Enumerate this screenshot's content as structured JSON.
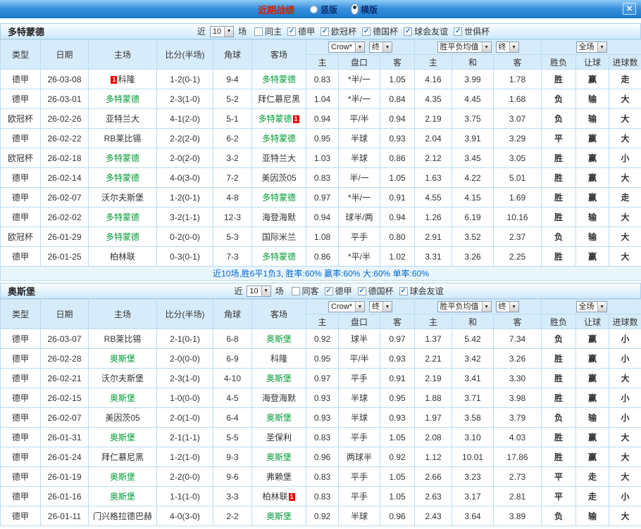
{
  "titlebar": {
    "title": "近期战绩",
    "layout_options": [
      {
        "label": "竖版",
        "selected": false
      },
      {
        "label": "横版",
        "selected": true
      }
    ],
    "close_label": "✕"
  },
  "colors": {
    "league_bundesliga": "#8f6dbe",
    "league_champions": "#e0622e",
    "focus_team_green": "#009933",
    "score_red": "#e60000",
    "result_red": "#e60000",
    "result_blue": "#2e6ed5",
    "result_green": "#1e9e3e",
    "accent_blue": "#1673cf"
  },
  "league_classes": {
    "德甲": "de",
    "欧冠杯": "cl"
  },
  "sections": [
    {
      "team": "多特蒙德",
      "filter": {
        "near_label": "近",
        "count": "10",
        "games_label": "场",
        "checkboxes": [
          {
            "label": "同主",
            "checked": false
          },
          {
            "label": "德甲",
            "checked": true
          },
          {
            "label": "欧冠杯",
            "checked": true
          },
          {
            "label": "德国杯",
            "checked": true
          },
          {
            "label": "球会友谊",
            "checked": true
          },
          {
            "label": "世俱杯",
            "checked": true
          }
        ]
      },
      "header": {
        "columns": [
          "类型",
          "日期",
          "主场",
          "比分(半场)",
          "角球",
          "客场"
        ],
        "odds_company_select": "Crow*",
        "odds_final_select": "终",
        "avg_select": "胜平负均值",
        "avg_final_select": "终",
        "fulltime_select": "全场",
        "subcolumns": [
          "主",
          "盘口",
          "客",
          "主",
          "和",
          "客",
          "胜负",
          "让球",
          "进球数"
        ]
      },
      "rows": [
        {
          "league": "德甲",
          "date": "26-03-08",
          "home": {
            "name": "科隆",
            "focus": false,
            "badge": "1",
            "badge_pos": "before"
          },
          "score": "1-2(0-1)",
          "corners": "9-4",
          "away": {
            "name": "多特蒙德",
            "focus": true
          },
          "odds": [
            "0.83",
            "*半/一",
            "1.05"
          ],
          "avg": [
            "4.16",
            "3.99",
            "1.78"
          ],
          "results": [
            {
              "text": "胜",
              "color": "red"
            },
            {
              "text": "赢",
              "color": "red"
            },
            {
              "text": "走",
              "color": "red"
            }
          ]
        },
        {
          "league": "德甲",
          "date": "26-03-01",
          "home": {
            "name": "多特蒙德",
            "focus": true
          },
          "score": "2-3(1-0)",
          "corners": "5-2",
          "away": {
            "name": "拜仁慕尼黑",
            "focus": false
          },
          "odds": [
            "1.04",
            "*半/一",
            "0.84"
          ],
          "avg": [
            "4.35",
            "4.45",
            "1.68"
          ],
          "results": [
            {
              "text": "负",
              "color": "red"
            },
            {
              "text": "输",
              "color": "blue"
            },
            {
              "text": "大",
              "color": "red"
            }
          ]
        },
        {
          "league": "欧冠杯",
          "date": "26-02-26",
          "home": {
            "name": "亚特兰大",
            "focus": false
          },
          "score": "4-1(2-0)",
          "corners": "5-1",
          "away": {
            "name": "多特蒙德",
            "focus": true,
            "badge": "1",
            "badge_pos": "after"
          },
          "odds": [
            "0.94",
            "平/半",
            "0.94"
          ],
          "avg": [
            "2.19",
            "3.75",
            "3.07"
          ],
          "results": [
            {
              "text": "负",
              "color": "red"
            },
            {
              "text": "输",
              "color": "blue"
            },
            {
              "text": "大",
              "color": "red"
            }
          ]
        },
        {
          "league": "德甲",
          "date": "26-02-22",
          "home": {
            "name": "RB莱比锡",
            "focus": false
          },
          "score": "2-2(2-0)",
          "corners": "6-2",
          "away": {
            "name": "多特蒙德",
            "focus": true
          },
          "odds": [
            "0.95",
            "半球",
            "0.93"
          ],
          "avg": [
            "2.04",
            "3.91",
            "3.29"
          ],
          "results": [
            {
              "text": "平",
              "color": "blue"
            },
            {
              "text": "赢",
              "color": "red"
            },
            {
              "text": "大",
              "color": "red"
            }
          ]
        },
        {
          "league": "欧冠杯",
          "date": "26-02-18",
          "home": {
            "name": "多特蒙德",
            "focus": true
          },
          "score": "2-0(2-0)",
          "corners": "3-2",
          "away": {
            "name": "亚特兰大",
            "focus": false
          },
          "odds": [
            "1.03",
            "半球",
            "0.86"
          ],
          "avg": [
            "2.12",
            "3.45",
            "3.05"
          ],
          "results": [
            {
              "text": "胜",
              "color": "red"
            },
            {
              "text": "赢",
              "color": "red"
            },
            {
              "text": "小",
              "color": "green"
            }
          ]
        },
        {
          "league": "德甲",
          "date": "26-02-14",
          "home": {
            "name": "多特蒙德",
            "focus": true
          },
          "score": "4-0(3-0)",
          "corners": "7-2",
          "away": {
            "name": "美因茨05",
            "focus": false
          },
          "odds": [
            "0.83",
            "半/一",
            "1.05"
          ],
          "avg": [
            "1.63",
            "4.22",
            "5.01"
          ],
          "results": [
            {
              "text": "胜",
              "color": "red"
            },
            {
              "text": "赢",
              "color": "red"
            },
            {
              "text": "大",
              "color": "red"
            }
          ]
        },
        {
          "league": "德甲",
          "date": "26-02-07",
          "home": {
            "name": "沃尔夫斯堡",
            "focus": false
          },
          "score": "1-2(0-1)",
          "corners": "4-8",
          "away": {
            "name": "多特蒙德",
            "focus": true
          },
          "odds": [
            "0.97",
            "*半/一",
            "0.91"
          ],
          "avg": [
            "4.55",
            "4.15",
            "1.69"
          ],
          "results": [
            {
              "text": "胜",
              "color": "red"
            },
            {
              "text": "赢",
              "color": "red"
            },
            {
              "text": "走",
              "color": "red"
            }
          ]
        },
        {
          "league": "德甲",
          "date": "26-02-02",
          "home": {
            "name": "多特蒙德",
            "focus": true
          },
          "score": "3-2(1-1)",
          "corners": "12-3",
          "away": {
            "name": "海登海默",
            "focus": false
          },
          "odds": [
            "0.94",
            "球半/两",
            "0.94"
          ],
          "avg": [
            "1.26",
            "6.19",
            "10.16"
          ],
          "results": [
            {
              "text": "胜",
              "color": "red"
            },
            {
              "text": "输",
              "color": "blue"
            },
            {
              "text": "大",
              "color": "red"
            }
          ]
        },
        {
          "league": "欧冠杯",
          "date": "26-01-29",
          "home": {
            "name": "多特蒙德",
            "focus": true
          },
          "score": "0-2(0-0)",
          "corners": "5-3",
          "away": {
            "name": "国际米兰",
            "focus": false
          },
          "odds": [
            "1.08",
            "平手",
            "0.80"
          ],
          "avg": [
            "2.91",
            "3.52",
            "2.37"
          ],
          "results": [
            {
              "text": "负",
              "color": "red"
            },
            {
              "text": "输",
              "color": "blue"
            },
            {
              "text": "大",
              "color": "red"
            }
          ]
        },
        {
          "league": "德甲",
          "date": "26-01-25",
          "home": {
            "name": "柏林联",
            "focus": false
          },
          "score": "0-3(0-1)",
          "corners": "7-3",
          "away": {
            "name": "多特蒙德",
            "focus": true
          },
          "odds": [
            "0.86",
            "*平/半",
            "1.02"
          ],
          "avg": [
            "3.31",
            "3.26",
            "2.25"
          ],
          "results": [
            {
              "text": "胜",
              "color": "red"
            },
            {
              "text": "赢",
              "color": "red"
            },
            {
              "text": "大",
              "color": "red"
            }
          ]
        }
      ],
      "summary": "近10场,胜6平1负3, 胜率:60% 赢率:60% 大:60% 单率:60%"
    },
    {
      "team": "奥斯堡",
      "filter": {
        "near_label": "近",
        "count": "10",
        "games_label": "场",
        "checkboxes": [
          {
            "label": "同客",
            "checked": false
          },
          {
            "label": "德甲",
            "checked": true
          },
          {
            "label": "德国杯",
            "checked": true
          },
          {
            "label": "球会友谊",
            "checked": true
          }
        ]
      },
      "header": {
        "columns": [
          "类型",
          "日期",
          "主场",
          "比分(半场)",
          "角球",
          "客场"
        ],
        "odds_company_select": "Crow*",
        "odds_final_select": "终",
        "avg_select": "胜平负均值",
        "avg_final_select": "终",
        "fulltime_select": "全场",
        "subcolumns": [
          "主",
          "盘口",
          "客",
          "主",
          "和",
          "客",
          "胜负",
          "让球",
          "进球数"
        ]
      },
      "rows": [
        {
          "league": "德甲",
          "date": "26-03-07",
          "home": {
            "name": "RB莱比锡",
            "focus": false
          },
          "score": "2-1(0-1)",
          "corners": "6-8",
          "away": {
            "name": "奥斯堡",
            "focus": true
          },
          "odds": [
            "0.92",
            "球半",
            "0.97"
          ],
          "avg": [
            "1.37",
            "5.42",
            "7.34"
          ],
          "results": [
            {
              "text": "负",
              "color": "red"
            },
            {
              "text": "赢",
              "color": "red"
            },
            {
              "text": "小",
              "color": "green"
            }
          ]
        },
        {
          "league": "德甲",
          "date": "26-02-28",
          "home": {
            "name": "奥斯堡",
            "focus": true
          },
          "score": "2-0(0-0)",
          "corners": "6-9",
          "away": {
            "name": "科隆",
            "focus": false
          },
          "odds": [
            "0.95",
            "平/半",
            "0.93"
          ],
          "avg": [
            "2.21",
            "3.42",
            "3.26"
          ],
          "results": [
            {
              "text": "胜",
              "color": "red"
            },
            {
              "text": "赢",
              "color": "red"
            },
            {
              "text": "小",
              "color": "green"
            }
          ]
        },
        {
          "league": "德甲",
          "date": "26-02-21",
          "home": {
            "name": "沃尔夫斯堡",
            "focus": false
          },
          "score": "2-3(1-0)",
          "corners": "4-10",
          "away": {
            "name": "奥斯堡",
            "focus": true
          },
          "odds": [
            "0.97",
            "平手",
            "0.91"
          ],
          "avg": [
            "2.19",
            "3.41",
            "3.30"
          ],
          "results": [
            {
              "text": "胜",
              "color": "red"
            },
            {
              "text": "赢",
              "color": "red"
            },
            {
              "text": "大",
              "color": "red"
            }
          ]
        },
        {
          "league": "德甲",
          "date": "26-02-15",
          "home": {
            "name": "奥斯堡",
            "focus": true
          },
          "score": "1-0(0-0)",
          "corners": "4-5",
          "away": {
            "name": "海登海默",
            "focus": false
          },
          "odds": [
            "0.93",
            "半球",
            "0.95"
          ],
          "avg": [
            "1.88",
            "3.71",
            "3.98"
          ],
          "results": [
            {
              "text": "胜",
              "color": "red"
            },
            {
              "text": "赢",
              "color": "red"
            },
            {
              "text": "小",
              "color": "green"
            }
          ]
        },
        {
          "league": "德甲",
          "date": "26-02-07",
          "home": {
            "name": "美因茨05",
            "focus": false
          },
          "score": "2-0(1-0)",
          "corners": "6-4",
          "away": {
            "name": "奥斯堡",
            "focus": true
          },
          "odds": [
            "0.93",
            "半球",
            "0.93"
          ],
          "avg": [
            "1.97",
            "3.58",
            "3.79"
          ],
          "results": [
            {
              "text": "负",
              "color": "red"
            },
            {
              "text": "输",
              "color": "blue"
            },
            {
              "text": "小",
              "color": "green"
            }
          ]
        },
        {
          "league": "德甲",
          "date": "26-01-31",
          "home": {
            "name": "奥斯堡",
            "focus": true
          },
          "score": "2-1(1-1)",
          "corners": "5-5",
          "away": {
            "name": "圣保利",
            "focus": false
          },
          "odds": [
            "0.83",
            "平手",
            "1.05"
          ],
          "avg": [
            "2.08",
            "3.10",
            "4.03"
          ],
          "results": [
            {
              "text": "胜",
              "color": "red"
            },
            {
              "text": "赢",
              "color": "red"
            },
            {
              "text": "大",
              "color": "red"
            }
          ]
        },
        {
          "league": "德甲",
          "date": "26-01-24",
          "home": {
            "name": "拜仁慕尼黑",
            "focus": false
          },
          "score": "1-2(1-0)",
          "corners": "9-3",
          "away": {
            "name": "奥斯堡",
            "focus": true
          },
          "odds": [
            "0.96",
            "两球半",
            "0.92"
          ],
          "avg": [
            "1.12",
            "10.01",
            "17.86"
          ],
          "results": [
            {
              "text": "胜",
              "color": "red"
            },
            {
              "text": "赢",
              "color": "red"
            },
            {
              "text": "大",
              "color": "red"
            }
          ]
        },
        {
          "league": "德甲",
          "date": "26-01-19",
          "home": {
            "name": "奥斯堡",
            "focus": true
          },
          "score": "2-2(0-0)",
          "corners": "9-6",
          "away": {
            "name": "弗赖堡",
            "focus": false
          },
          "odds": [
            "0.83",
            "平手",
            "1.05"
          ],
          "avg": [
            "2.66",
            "3.23",
            "2.73"
          ],
          "results": [
            {
              "text": "平",
              "color": "blue"
            },
            {
              "text": "走",
              "color": "blue"
            },
            {
              "text": "大",
              "color": "red"
            }
          ]
        },
        {
          "league": "德甲",
          "date": "26-01-16",
          "home": {
            "name": "奥斯堡",
            "focus": true
          },
          "score": "1-1(1-0)",
          "corners": "3-3",
          "away": {
            "name": "柏林联",
            "focus": false,
            "badge": "1",
            "badge_pos": "after"
          },
          "odds": [
            "0.83",
            "平手",
            "1.05"
          ],
          "avg": [
            "2.63",
            "3.17",
            "2.81"
          ],
          "results": [
            {
              "text": "平",
              "color": "blue"
            },
            {
              "text": "走",
              "color": "blue"
            },
            {
              "text": "小",
              "color": "green"
            }
          ]
        },
        {
          "league": "德甲",
          "date": "26-01-11",
          "home": {
            "name": "门兴格拉德巴赫",
            "focus": false
          },
          "score": "4-0(3-0)",
          "corners": "2-2",
          "away": {
            "name": "奥斯堡",
            "focus": true
          },
          "odds": [
            "0.92",
            "半球",
            "0.96"
          ],
          "avg": [
            "2.43",
            "3.64",
            "3.89"
          ],
          "results": [
            {
              "text": "负",
              "color": "red"
            },
            {
              "text": "输",
              "color": "blue"
            },
            {
              "text": "大",
              "color": "red"
            }
          ]
        }
      ],
      "summary": ""
    }
  ]
}
